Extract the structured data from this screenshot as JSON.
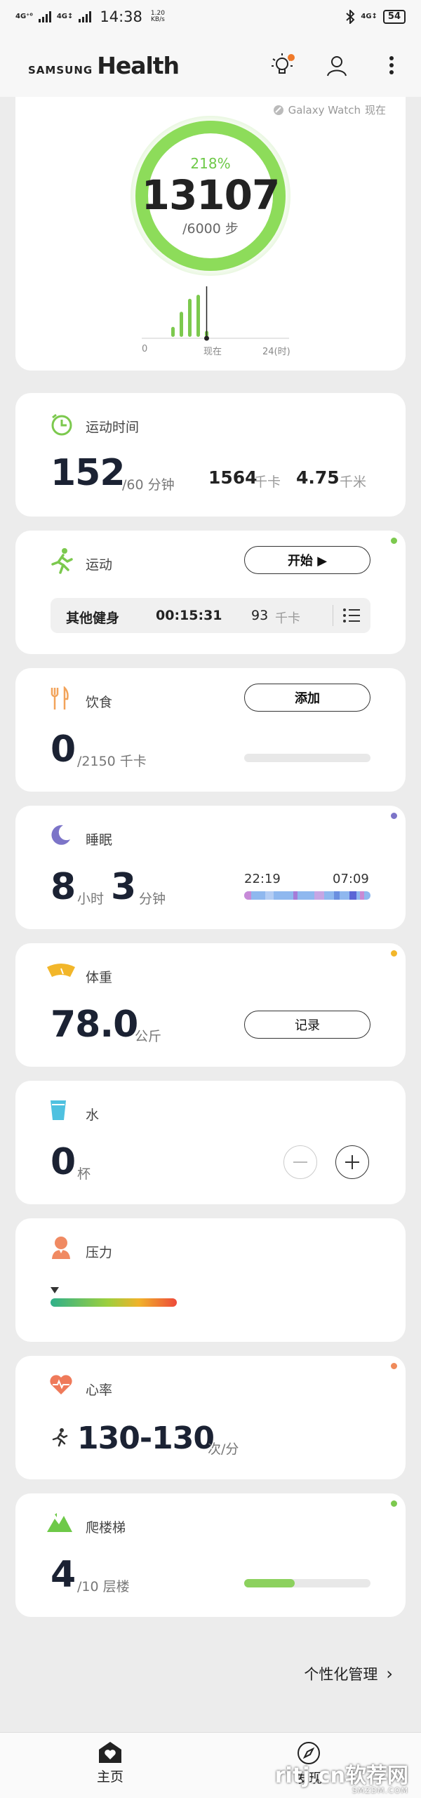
{
  "status_bar": {
    "net1": "4G⁺⁰",
    "net2": "4G↕",
    "time": "14:38",
    "speed_value": "1.20",
    "speed_unit": "KB/s",
    "net3": "4G↕",
    "battery": "54"
  },
  "app_bar": {
    "brand_small": "SAMSUNG",
    "brand_large": "Health"
  },
  "steps": {
    "device": "Galaxy Watch",
    "device_time": "现在",
    "percent": "218%",
    "count": "13107",
    "goal": "/6000 步",
    "progress_fraction": 1.0,
    "axis": {
      "start": "0",
      "now": "现在",
      "end": "24(时)"
    },
    "bars": [
      10,
      25,
      38,
      42,
      6
    ],
    "colors": {
      "ring": "#8ddc5a",
      "bars": "#7cc94e"
    }
  },
  "active_time": {
    "title": "运动时间",
    "minutes": "152",
    "minutes_goal": "/60 分钟",
    "kcal_value": "1564",
    "kcal_unit": "千卡",
    "km_value": "4.75",
    "km_unit": "千米",
    "icon": "stopwatch-icon",
    "color": "#7cc94e"
  },
  "exercise": {
    "title": "运动",
    "start_label": "开始 ▶",
    "last": {
      "name": "其他健身",
      "duration": "00:15:31",
      "kcal_value": "93",
      "kcal_unit": "千卡"
    },
    "icon": "running-icon",
    "dot_color": "#7cc94e"
  },
  "food": {
    "title": "饮食",
    "add_label": "添加",
    "value": "0",
    "goal": "/2150 千卡",
    "progress_fraction": 0,
    "icon": "fork-knife-icon"
  },
  "sleep": {
    "title": "睡眠",
    "hours": "8",
    "hours_unit": "小时",
    "minutes": "3",
    "minutes_unit": "分钟",
    "start_time": "22:19",
    "end_time": "07:09",
    "icon": "moon-icon",
    "dot_color": "#7c74c8"
  },
  "weight": {
    "title": "体重",
    "value": "78.0",
    "unit": "公斤",
    "record_label": "记录",
    "icon": "scale-icon",
    "dot_color": "#f2b62a"
  },
  "water": {
    "title": "水",
    "value": "0",
    "unit": "杯",
    "icon": "cup-icon"
  },
  "stress": {
    "title": "压力",
    "icon": "stress-person-icon",
    "level_fraction": 0.0
  },
  "heart": {
    "title": "心率",
    "value": "130-130",
    "unit": "次/分",
    "icon": "heart-icon",
    "dot_color": "#ef8a5a"
  },
  "floors": {
    "title": "爬楼梯",
    "value": "4",
    "goal": "/10 层楼",
    "progress_fraction": 0.4,
    "icon": "mountain-icon",
    "dot_color": "#7cc94e"
  },
  "manage": {
    "label": "个性化管理",
    "chevron": "›"
  },
  "bottom_nav": {
    "home": "主页",
    "discover": "发现"
  },
  "watermark": {
    "main": "ritj.cn软荐网",
    "sub": "SMZDM.COM"
  }
}
